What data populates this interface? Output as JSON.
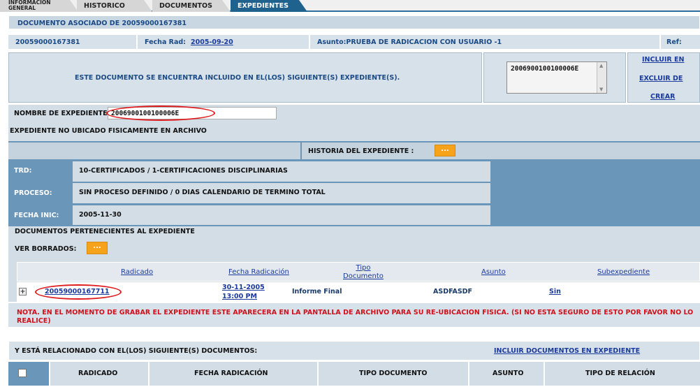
{
  "tabs": [
    {
      "label": "INFORMACION GENERAL",
      "line1": "INFORMACION",
      "line2": "GENERAL"
    },
    {
      "label": "HISTORICO"
    },
    {
      "label": "DOCUMENTOS"
    },
    {
      "label": "EXPEDIENTES"
    }
  ],
  "header": {
    "title": "DOCUMENTO ASOCIADO DE 20059000167381"
  },
  "info_row": {
    "radicado": "20059000167381",
    "fecha_label": "Fecha Rad:",
    "fecha_value": "2005-09-20",
    "asunto": "Asunto:PRUEBA DE RADICACION CON USUARIO -1",
    "ref_label": "Ref:"
  },
  "included": {
    "message": "ESTE DOCUMENTO SE ENCUENTRA INCLUIDO EN EL(LOS) SIGUIENTE(S) EXPEDIENTE(S).",
    "list_item": "2006900100100006E",
    "links": [
      "INCLUIR EN",
      "EXCLUIR DE",
      "CREAR"
    ]
  },
  "expediente": {
    "nombre_label": "NOMBRE DE EXPEDIENTE",
    "nombre_value": "2006900100100006E",
    "ubicacion": "EXPEDIENTE NO UBICADO FISICAMENTE EN ARCHIVO",
    "historia_label": "HISTORIA DEL EXPEDIENTE :",
    "btn_dots": "...",
    "trd_label": "TRD:",
    "trd_value": "10-CERTIFICADOS / 1-CERTIFICACIONES DISCIPLINARIAS",
    "proceso_label": "PROCESO:",
    "proceso_value": "SIN PROCESO DEFINIDO / 0 DIAS CALENDARIO DE TERMINO TOTAL",
    "fecha_label": "FECHA INIC:",
    "fecha_value": "2005-11-30",
    "docs_label": "DOCUMENTOS PERTENECIENTES AL EXPEDIENTE",
    "ver_borrados": "VER BORRADOS:"
  },
  "docs_table": {
    "headers": [
      "Radicado",
      "Fecha Radicación",
      "Tipo Documento",
      "Asunto",
      "Subexpediente"
    ],
    "tipo_line1": "Tipo",
    "tipo_line2": "Documento",
    "row": {
      "expand": "+",
      "radicado": "20059000167711",
      "fecha_line1": "30-11-2005",
      "fecha_line2": "13:00 PM",
      "tipo": "Informe Final",
      "asunto": "ASDFASDF",
      "sub": "Sin"
    }
  },
  "nota": "NOTA. EN EL MOMENTO DE GRABAR EL EXPEDIENTE ESTE APARECERA EN LA PANTALLA DE ARCHIVO PARA SU RE-UBICACION FISICA. (SI NO ESTA SEGURO DE ESTO POR FAVOR NO LO REALICE)",
  "related": {
    "title": "Y ESTÁ RELACIONADO CON EL(LOS) SIGUIENTE(S) DOCUMENTOS:",
    "link": "INCLUIR DOCUMENTOS EN EXPEDIENTE",
    "headers": [
      "RADICADO",
      "FECHA RADICACIÓN",
      "TIPO DOCUMENTO",
      "ASUNTO",
      "TIPO DE RELACIÓN"
    ]
  },
  "colors": {
    "tab_active": "#20628e",
    "bar_blue": "#6a96b9",
    "light_cell": "#d7e1e9",
    "orange": "#f7a21b",
    "alert_red": "#e0191c"
  }
}
